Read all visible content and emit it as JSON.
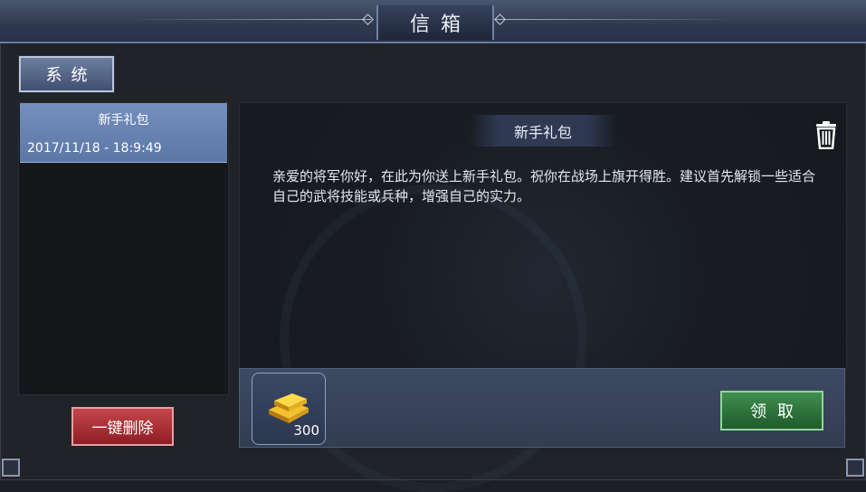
{
  "window": {
    "title": "信箱"
  },
  "tabs": [
    {
      "label": "系统",
      "active": true
    }
  ],
  "mail_list": [
    {
      "subject": "新手礼包",
      "date": "2017/11/18 - 18:9:49",
      "selected": true
    }
  ],
  "actions": {
    "delete_all_label": "一键删除",
    "claim_label": "领取"
  },
  "mail": {
    "subject": "新手礼包",
    "body": "亲爱的将军你好，在此为你送上新手礼包。祝你在战场上旗开得胜。建议首先解锁一些适合自己的武将技能或兵种，增强自己的实力。"
  },
  "rewards": [
    {
      "icon": "gold-ingot-icon",
      "quantity": "300"
    }
  ],
  "colors": {
    "selected_item": "#6b86b5",
    "delete_button": "#a8323a",
    "claim_button": "#2f7a3e"
  }
}
